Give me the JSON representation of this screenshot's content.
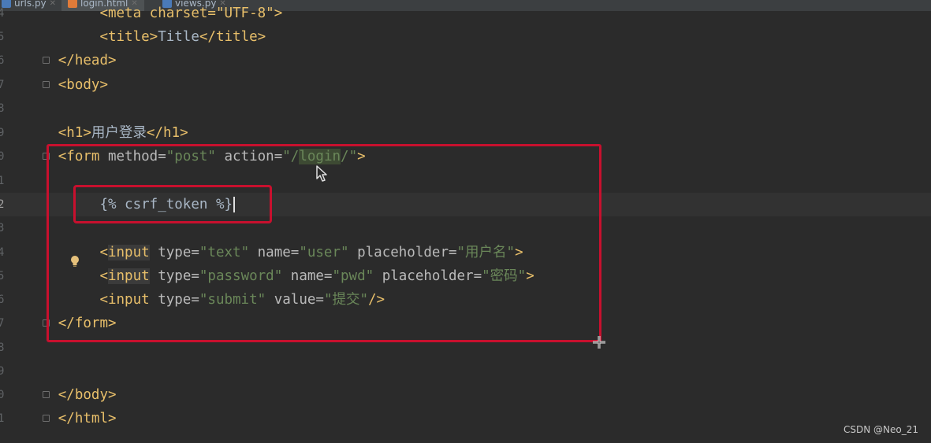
{
  "tabs": [
    {
      "label": "urls.py",
      "icon": "python-file-icon"
    },
    {
      "label": "login.html",
      "icon": "html-file-icon",
      "active": true
    },
    {
      "label": "views.py",
      "icon": "python-file-icon"
    }
  ],
  "colors": {
    "background": "#2b2b2b",
    "tag": "#e8bf6a",
    "attribute": "#bababa",
    "string": "#6a8759",
    "highlight_box": "#c8102e"
  },
  "line_numbers": [
    "4",
    "5",
    "6",
    "7",
    "8",
    "9",
    "0",
    "1",
    "2",
    "3",
    "4",
    "5",
    "6",
    "7",
    "8",
    "9",
    "0",
    "1"
  ],
  "code": {
    "meta_line": "<meta charset=\"UTF-8\">",
    "title_open": "<title>",
    "title_text": "Title",
    "title_close": "</title>",
    "head_close": "</head>",
    "body_open": "<body>",
    "h1_open": "<h1>",
    "h1_text": "用户登录",
    "h1_close": "</h1>",
    "form_open": "<form",
    "form_method_attr": " method=",
    "form_method_val": "\"post\"",
    "form_action_attr": " action=",
    "form_action_q1": "\"/",
    "form_action_login": "login",
    "form_action_q2": "/\"",
    "form_close_bracket": ">",
    "csrf": "{% csrf_token %}",
    "input1_lt": "<",
    "input1_tag": "input",
    "input1_type_attr": " type=",
    "input1_type_val": "\"text\"",
    "input1_name_attr": " name=",
    "input1_name_val": "\"user\"",
    "input1_ph_attr": " placeholder=",
    "input1_ph_val": "\"用户名\"",
    "input1_end": ">",
    "input2_lt": "<",
    "input2_tag": "input",
    "input2_type_attr": " type=",
    "input2_type_val": "\"password\"",
    "input2_name_attr": " name=",
    "input2_name_val": "\"pwd\"",
    "input2_ph_attr": " placeholder=",
    "input2_ph_val": "\"密码\"",
    "input2_end": ">",
    "input3_tag": "<input",
    "input3_type_attr": " type=",
    "input3_type_val": "\"submit\"",
    "input3_value_attr": " value=",
    "input3_value_val": "\"提交\"",
    "input3_end": "/>",
    "form_close": "</form>",
    "body_close": "</body>",
    "html_close": "</html>"
  },
  "watermark": "CSDN @Neo_21"
}
